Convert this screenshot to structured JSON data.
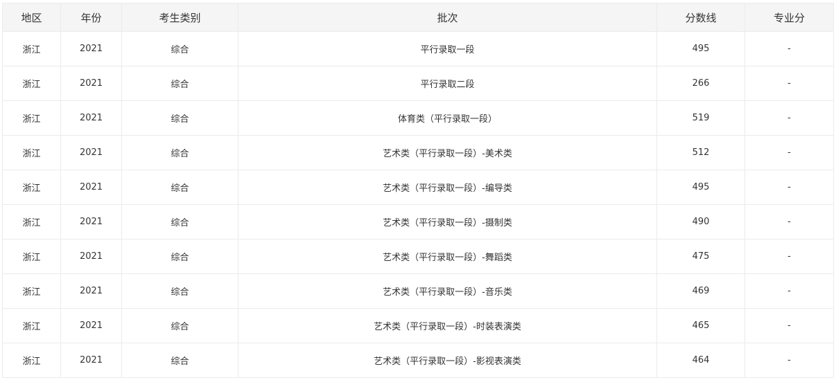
{
  "table": {
    "headers": [
      "地区",
      "年份",
      "考生类别",
      "批次",
      "分数线",
      "专业分"
    ],
    "rows": [
      [
        "浙江",
        "2021",
        "综合",
        "平行录取一段",
        "495",
        "-"
      ],
      [
        "浙江",
        "2021",
        "综合",
        "平行录取二段",
        "266",
        "-"
      ],
      [
        "浙江",
        "2021",
        "综合",
        "体育类（平行录取一段）",
        "519",
        "-"
      ],
      [
        "浙江",
        "2021",
        "综合",
        "艺术类（平行录取一段）-美术类",
        "512",
        "-"
      ],
      [
        "浙江",
        "2021",
        "综合",
        "艺术类（平行录取一段）-编导类",
        "495",
        "-"
      ],
      [
        "浙江",
        "2021",
        "综合",
        "艺术类（平行录取一段）-摄制类",
        "490",
        "-"
      ],
      [
        "浙江",
        "2021",
        "综合",
        "艺术类（平行录取一段）-舞蹈类",
        "475",
        "-"
      ],
      [
        "浙江",
        "2021",
        "综合",
        "艺术类（平行录取一段）-音乐类",
        "469",
        "-"
      ],
      [
        "浙江",
        "2021",
        "综合",
        "艺术类（平行录取一段）-时装表演类",
        "465",
        "-"
      ],
      [
        "浙江",
        "2021",
        "综合",
        "艺术类（平行录取一段）-影视表演类",
        "464",
        "-"
      ]
    ]
  }
}
